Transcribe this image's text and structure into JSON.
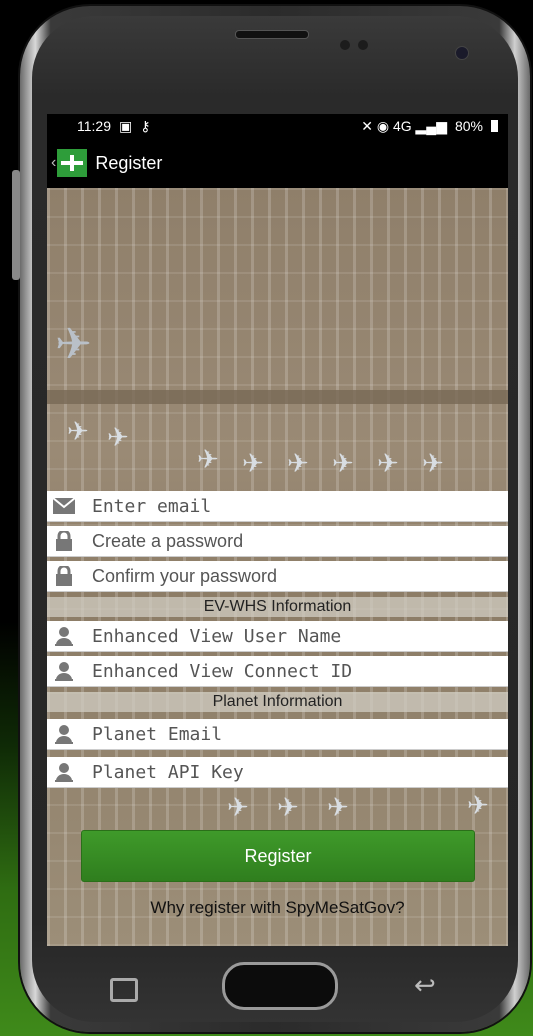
{
  "status_bar": {
    "time": "11:29",
    "indicators": "✕ ◉ 4G ▂▄▆",
    "battery": "80%"
  },
  "app_bar": {
    "title": "Register"
  },
  "form": {
    "email_placeholder": "Enter email",
    "password_placeholder": "Create a password",
    "confirm_placeholder": "Confirm your password",
    "ev_section_label": "EV-WHS Information",
    "ev_user_placeholder": "Enhanced View User Name",
    "ev_connect_placeholder": "Enhanced View Connect ID",
    "planet_section_label": "Planet Information",
    "planet_email_placeholder": "Planet Email",
    "planet_api_placeholder": "Planet API Key"
  },
  "actions": {
    "register_label": "Register",
    "why_link": "Why register with SpyMeSatGov?"
  },
  "colors": {
    "accent_green": "#2f7e1e",
    "logo_green": "#2e9d3a"
  },
  "icons": {
    "email": "envelope-icon",
    "password": "lock-icon",
    "user": "person-icon"
  }
}
